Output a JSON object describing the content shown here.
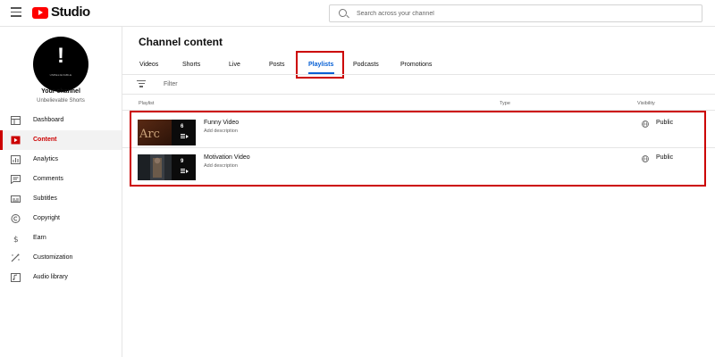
{
  "app": {
    "logo_text": "Studio"
  },
  "search": {
    "placeholder": "Search across your channel"
  },
  "channel": {
    "label": "Your channel",
    "name": "Unbelievable Shorts",
    "avatar_caption": "UNBELIEVABLE"
  },
  "sidebar": {
    "items": [
      {
        "label": "Dashboard",
        "icon": "dashboard-icon"
      },
      {
        "label": "Content",
        "icon": "content-icon",
        "active": true
      },
      {
        "label": "Analytics",
        "icon": "analytics-icon"
      },
      {
        "label": "Comments",
        "icon": "comments-icon"
      },
      {
        "label": "Subtitles",
        "icon": "subtitles-icon"
      },
      {
        "label": "Copyright",
        "icon": "copyright-icon"
      },
      {
        "label": "Earn",
        "icon": "earn-icon"
      },
      {
        "label": "Customization",
        "icon": "customization-icon"
      },
      {
        "label": "Audio library",
        "icon": "audio-library-icon"
      }
    ]
  },
  "main": {
    "title": "Channel content",
    "tabs": [
      "Videos",
      "Shorts",
      "Live",
      "Posts",
      "Playlists",
      "Podcasts",
      "Promotions"
    ],
    "active_tab": "Playlists",
    "filter_label": "Filter",
    "columns": {
      "playlist": "Playlist",
      "type": "Type",
      "visibility": "Visibility"
    },
    "playlists": [
      {
        "title": "Funny Video",
        "description": "Add description",
        "video_count": "6",
        "thumb_text": "Arc",
        "visibility": "Public"
      },
      {
        "title": "Motivation Video",
        "description": "Add description",
        "video_count": "9",
        "visibility": "Public"
      }
    ]
  },
  "colors": {
    "accent_red": "#cc0000",
    "brand_red": "#ff0000",
    "tab_active": "#065fd4"
  }
}
